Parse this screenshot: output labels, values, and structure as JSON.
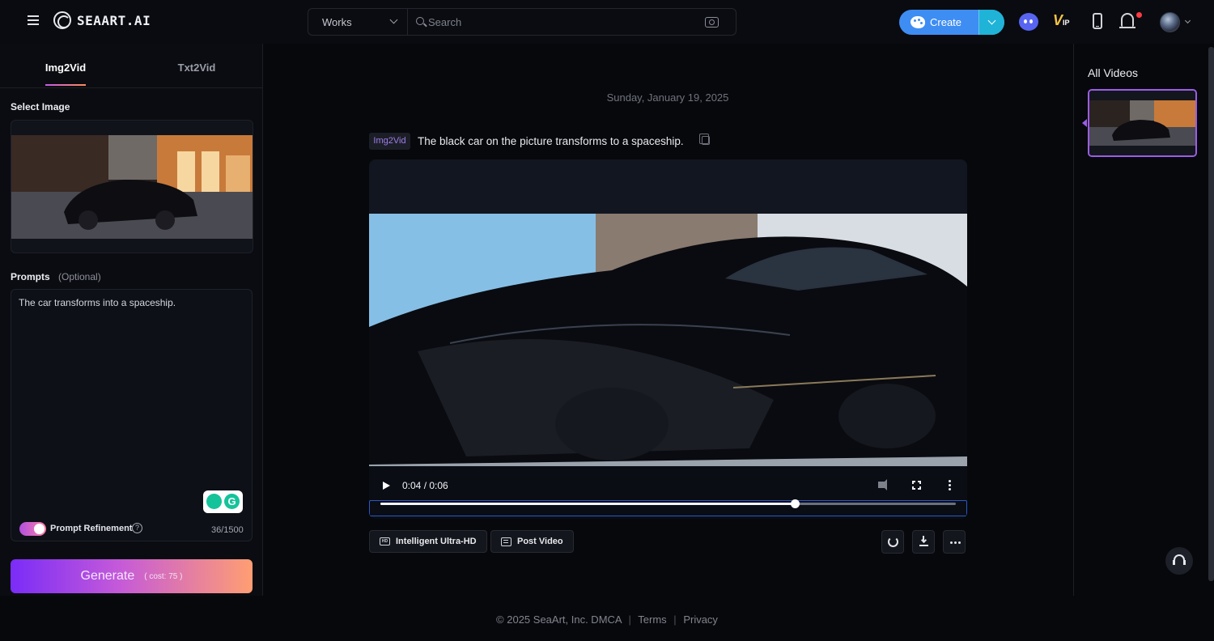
{
  "app": {
    "logo_text": "SEAART.AI"
  },
  "header": {
    "search": {
      "scope": "Works",
      "placeholder": "Search"
    },
    "create_label": "Create",
    "vip_label": "V",
    "vip_sub": "IP"
  },
  "left_panel": {
    "tabs": [
      {
        "label": "Img2Vid",
        "active": true
      },
      {
        "label": "Txt2Vid",
        "active": false
      }
    ],
    "select_image_label": "Select Image",
    "prompts_label": "Prompts",
    "prompts_optional": "(Optional)",
    "prompt_text": "The car transforms into a spaceship.",
    "grammarly_label": "G",
    "refinement_label": "Prompt Refinement",
    "refinement_enabled": true,
    "help_glyph": "?",
    "char_count": "36/1500",
    "generate_label": "Generate",
    "generate_cost": "( cost: 75 )"
  },
  "main": {
    "date": "Sunday, January 19, 2025",
    "task": {
      "tag": "Img2Vid",
      "prompt": "The black car on the picture transforms to a spaceship.",
      "video": {
        "time": "0:04 / 0:06",
        "progress": 0.72
      },
      "actions": {
        "ultra_hd_label": "Intelligent Ultra-HD",
        "post_label": "Post Video",
        "hd_glyph": "HD"
      }
    }
  },
  "right_panel": {
    "title": "All Videos"
  },
  "footer": {
    "copyright": "© 2025 SeaArt, Inc. DMCA",
    "links": [
      "Terms",
      "Privacy"
    ],
    "separator": "|"
  },
  "colors": {
    "accent_blue": "#3e8df3",
    "accent_purple": "#9b5de5",
    "gradient_start": "#7a2cf7",
    "gradient_end": "#ff9e72"
  }
}
